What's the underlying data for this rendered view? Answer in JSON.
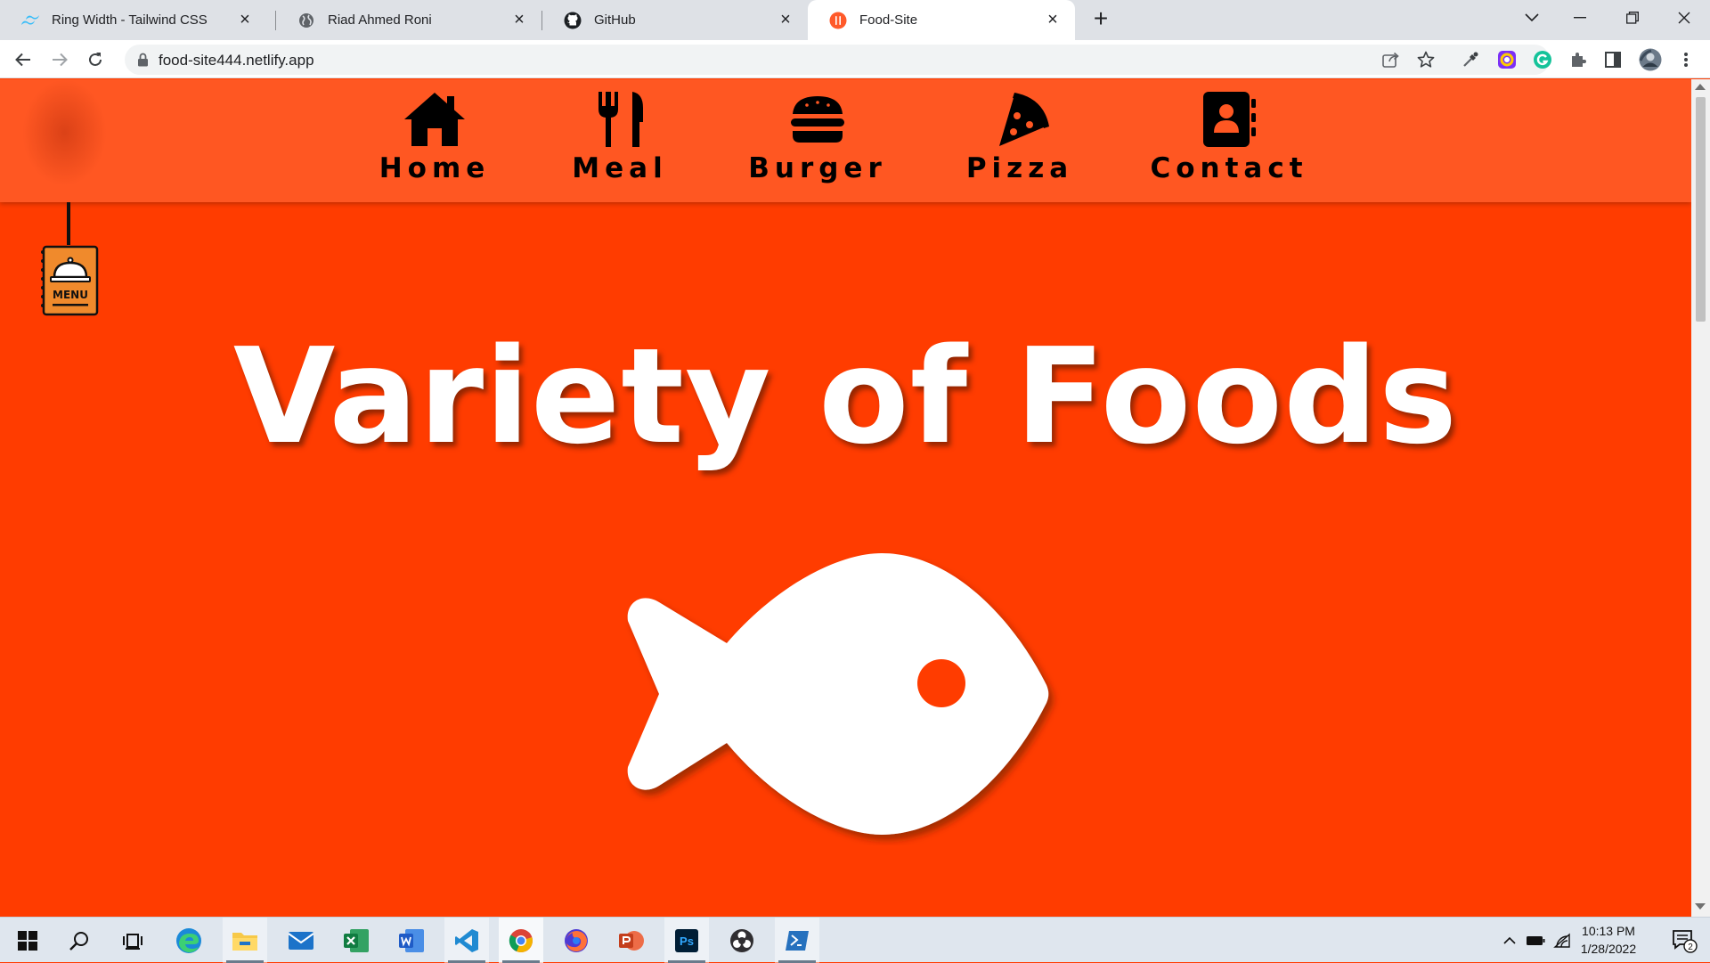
{
  "browser": {
    "tabs": [
      {
        "title": "Ring Width - Tailwind CSS",
        "icon": "tailwind-icon"
      },
      {
        "title": "Riad Ahmed Roni",
        "icon": "globe-icon"
      },
      {
        "title": "GitHub",
        "icon": "github-icon"
      },
      {
        "title": "Food-Site",
        "icon": "food-site-icon",
        "active": true
      }
    ],
    "url": "food-site444.netlify.app"
  },
  "page": {
    "nav": [
      {
        "label": "Home",
        "icon": "house-icon"
      },
      {
        "label": "Meal",
        "icon": "utensils-icon"
      },
      {
        "label": "Burger",
        "icon": "burger-icon"
      },
      {
        "label": "Pizza",
        "icon": "pizza-icon"
      },
      {
        "label": "Contact",
        "icon": "contact-book-icon"
      }
    ],
    "menu_sign_text": "MENU",
    "headline": "Variety of Foods",
    "hero_icon": "fish-icon",
    "colors": {
      "navbar": "#ff5722",
      "background": "#ff3c00",
      "text": "#ffffff"
    }
  },
  "taskbar": {
    "apps": [
      "windows-start-icon",
      "search-icon",
      "task-view-icon",
      "edge-icon",
      "file-explorer-icon",
      "mail-icon",
      "excel-icon",
      "word-icon",
      "vscode-icon",
      "chrome-icon",
      "firefox-icon",
      "powerpoint-icon",
      "photoshop-icon",
      "obs-icon",
      "powershell-icon"
    ],
    "time": "10:13 PM",
    "date": "1/28/2022",
    "notification_count": "2"
  }
}
